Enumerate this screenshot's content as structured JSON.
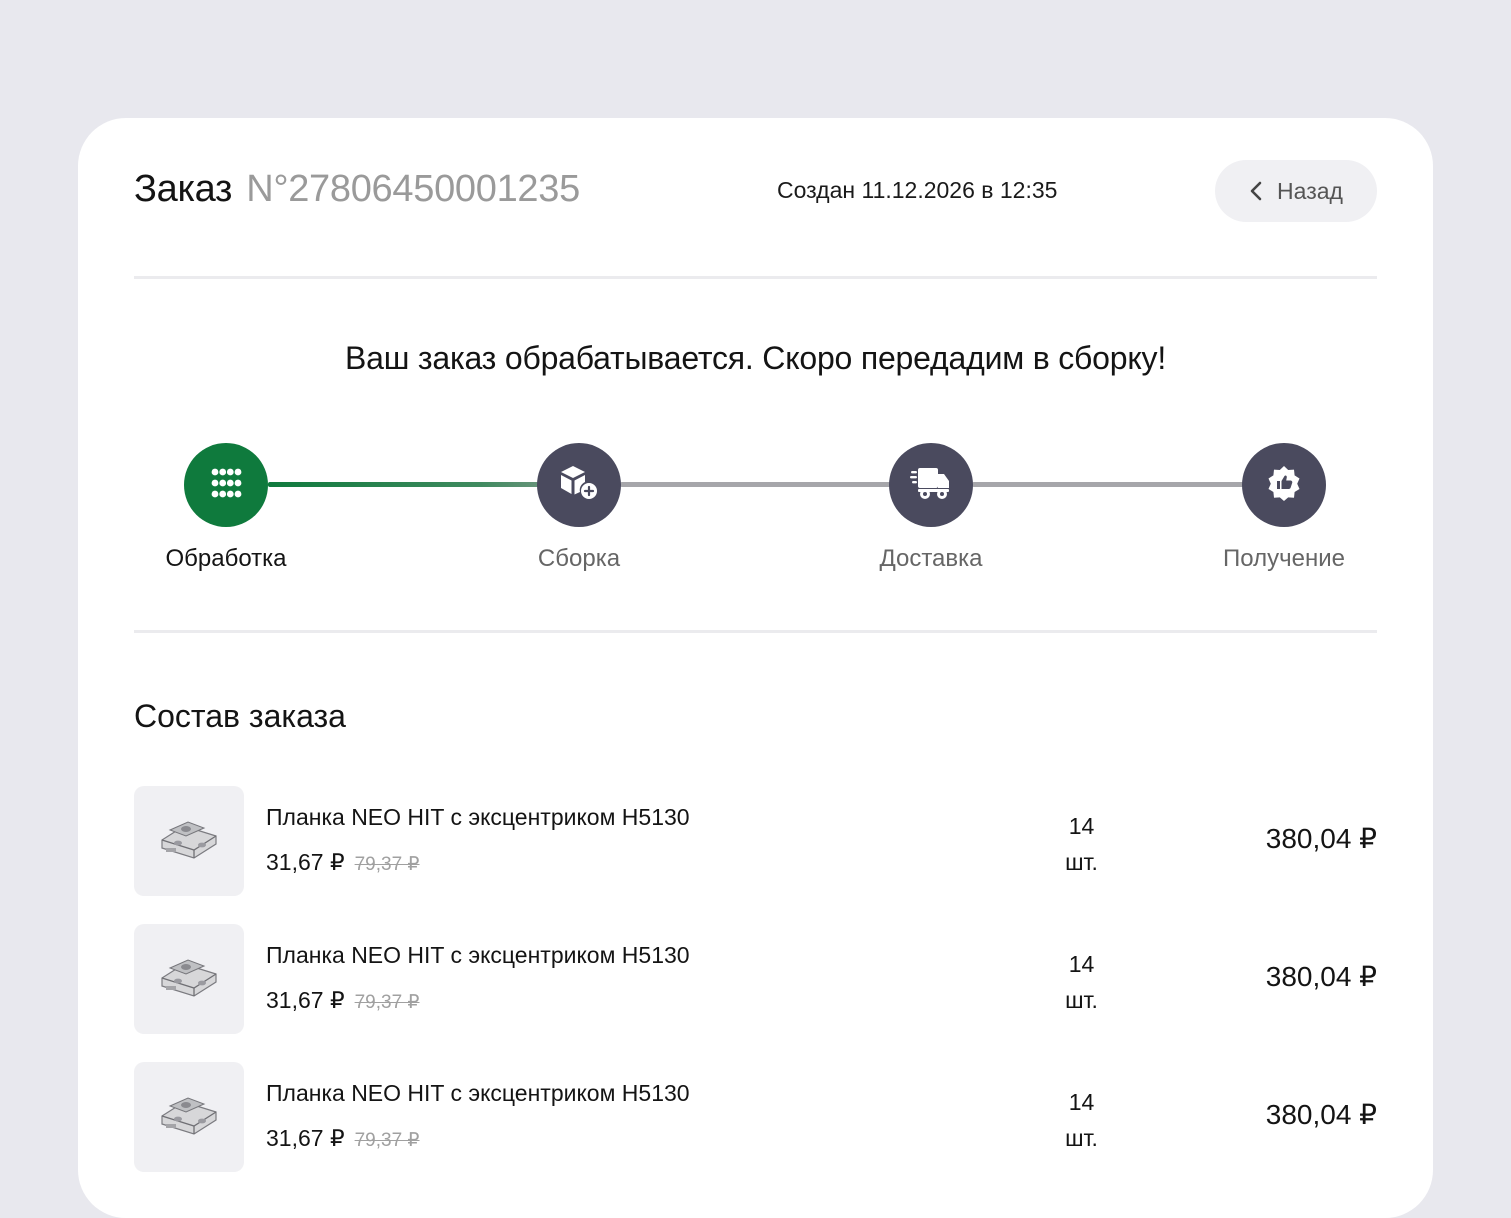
{
  "order": {
    "title_label": "Заказ",
    "number": "N°27806450001235",
    "created": "Создан 11.12.2026 в 12:35",
    "back_label": "Назад"
  },
  "status": {
    "message": "Ваш заказ обрабатывается. Скоро передадим в сборку!"
  },
  "steps": [
    {
      "label": "Обработка",
      "icon": "dots-grid-icon",
      "active": true
    },
    {
      "label": "Сборка",
      "icon": "box-plus-icon",
      "active": false
    },
    {
      "label": "Доставка",
      "icon": "truck-icon",
      "active": false
    },
    {
      "label": "Получение",
      "icon": "thumbs-up-badge-icon",
      "active": false
    }
  ],
  "colors": {
    "accent": "#0f7a3d",
    "inactive_step": "#4a4a5e",
    "background": "#e8e8ee"
  },
  "composition": {
    "title": "Состав заказа",
    "items": [
      {
        "name": "Планка NEO HIT с эксцентриком H5130",
        "price": "31,67 ₽",
        "old_price": "79,37 ₽",
        "qty": "14",
        "unit": "шт.",
        "total": "380,04 ₽"
      },
      {
        "name": "Планка NEO HIT с эксцентриком H5130",
        "price": "31,67 ₽",
        "old_price": "79,37 ₽",
        "qty": "14",
        "unit": "шт.",
        "total": "380,04 ₽"
      },
      {
        "name": "Планка NEO HIT с эксцентриком H5130",
        "price": "31,67 ₽",
        "old_price": "79,37 ₽",
        "qty": "14",
        "unit": "шт.",
        "total": "380,04 ₽"
      }
    ]
  }
}
